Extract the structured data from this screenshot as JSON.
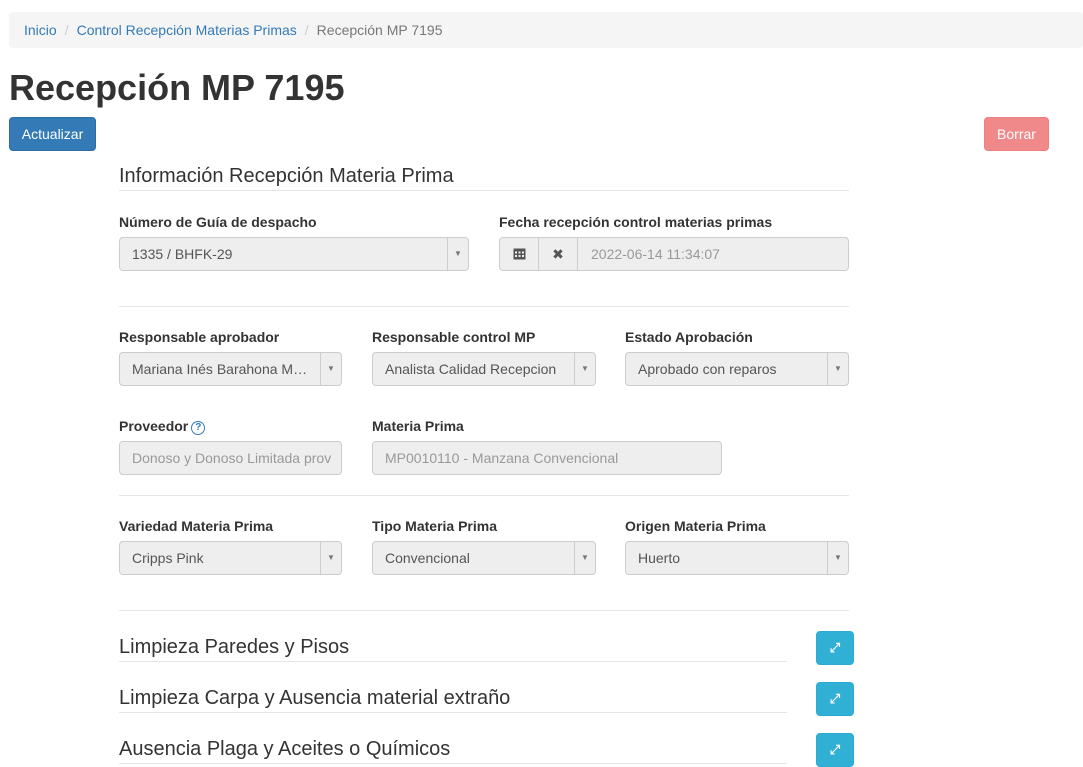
{
  "breadcrumb": {
    "home": "Inicio",
    "parent": "Control Recepción Materias Primas",
    "current": "Recepción MP 7195"
  },
  "page_title": "Recepción MP 7195",
  "actions": {
    "update_label": "Actualizar",
    "delete_label": "Borrar"
  },
  "section_title": "Información Recepción Materia Prima",
  "fields": {
    "guia": {
      "label": "Número de Guía de despacho",
      "value": "1335 / BHFK-29"
    },
    "fecha": {
      "label": "Fecha recepción control materias primas",
      "value": "2022-06-14 11:34:07"
    },
    "aprobador": {
      "label": "Responsable aprobador",
      "value": "Mariana Inés Barahona Me…"
    },
    "control": {
      "label": "Responsable control MP",
      "value": "Analista Calidad Recepcion"
    },
    "estado": {
      "label": "Estado Aprobación",
      "value": "Aprobado con reparos"
    },
    "proveedor": {
      "label": "Proveedor",
      "value": "Donoso y Donoso Limitada prov"
    },
    "materia": {
      "label": "Materia Prima",
      "value": "MP0010110 - Manzana Convencional"
    },
    "variedad": {
      "label": "Variedad Materia Prima",
      "value": "Cripps Pink"
    },
    "tipo": {
      "label": "Tipo Materia Prima",
      "value": "Convencional"
    },
    "origen": {
      "label": "Origen Materia Prima",
      "value": "Huerto"
    }
  },
  "panels": [
    {
      "title": "Limpieza Paredes y Pisos"
    },
    {
      "title": "Limpieza Carpa y Ausencia material extraño"
    },
    {
      "title": "Ausencia Plaga y Aceites o Químicos"
    }
  ],
  "icons": {
    "calendar": "calendar-icon",
    "clear": "close-icon",
    "caret": "chevron-down-icon",
    "help": "question-circle-icon",
    "expand": "expand-icon"
  },
  "colors": {
    "primary": "#337ab7",
    "danger": "#f0898a",
    "info": "#31b0d5"
  }
}
